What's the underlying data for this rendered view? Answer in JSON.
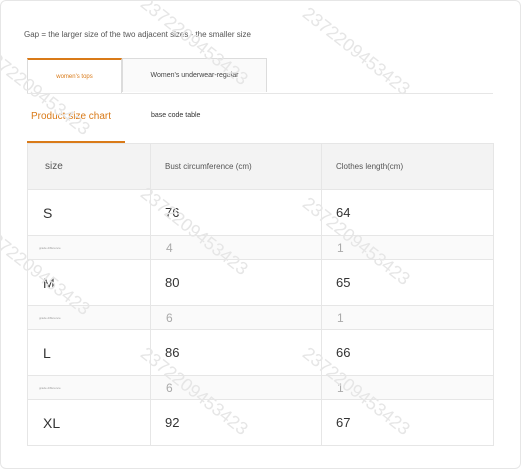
{
  "note": "Gap = the larger size of the two adjacent sizes - the smaller size",
  "tabs": [
    {
      "label": "women's tops",
      "active": true
    },
    {
      "label": "Women's underwear-regular",
      "active": false
    }
  ],
  "sub_tabs": [
    {
      "label": "Product size chart",
      "active": true
    },
    {
      "label": "base code table",
      "active": false
    }
  ],
  "table": {
    "headers": [
      "size",
      "Bust circumference (cm)",
      "Clothes length(cm)"
    ],
    "rows": [
      {
        "type": "size",
        "cells": [
          "S",
          "76",
          "64"
        ]
      },
      {
        "type": "diff",
        "cells": [
          "grade difference",
          "4",
          "1"
        ]
      },
      {
        "type": "size",
        "cells": [
          "M",
          "80",
          "65"
        ]
      },
      {
        "type": "diff",
        "cells": [
          "grade difference",
          "6",
          "1"
        ]
      },
      {
        "type": "size",
        "cells": [
          "L",
          "86",
          "66"
        ]
      },
      {
        "type": "diff",
        "cells": [
          "grade difference",
          "6",
          "1"
        ]
      },
      {
        "type": "size",
        "cells": [
          "XL",
          "92",
          "67"
        ]
      }
    ]
  },
  "watermark": "2372209453423",
  "colors": {
    "accent": "#d97a18",
    "border": "#e6e6e6",
    "header_bg": "#f3f3f3"
  }
}
